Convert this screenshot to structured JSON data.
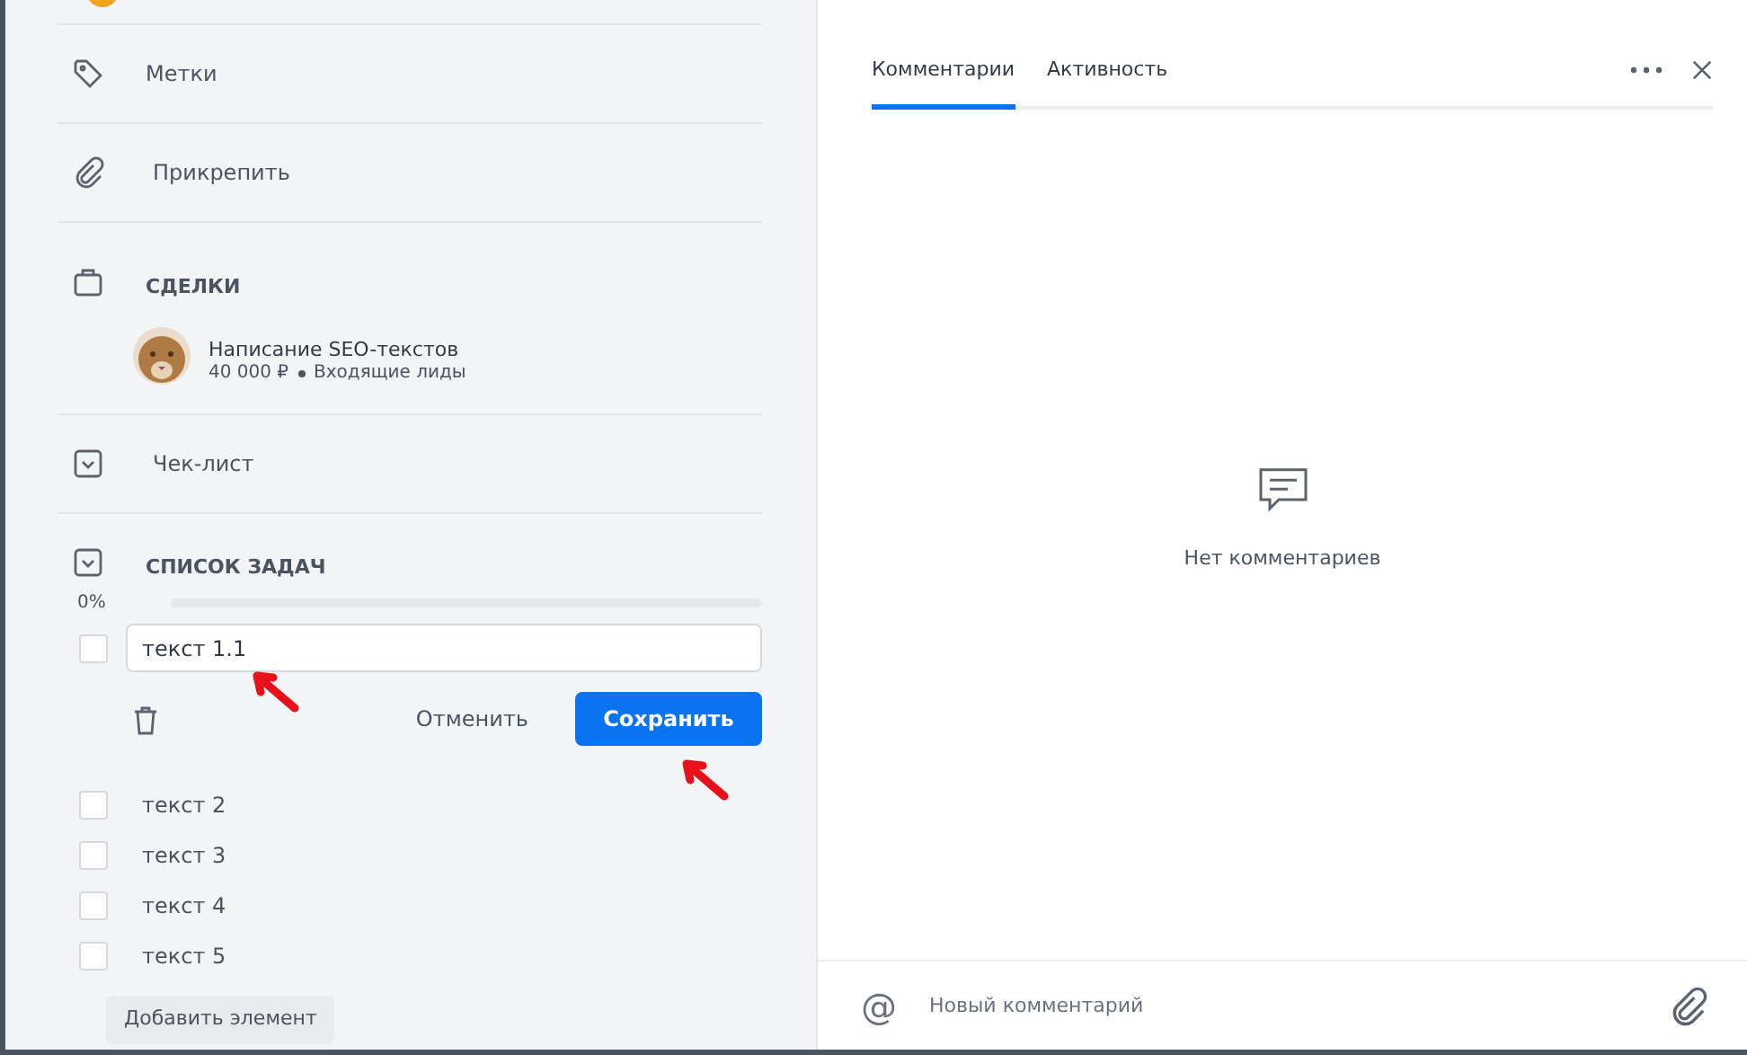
{
  "details": {
    "sections": [
      {
        "kind": "link",
        "label": "Метки"
      },
      {
        "kind": "link",
        "label": "Прикрепить"
      },
      {
        "kind": "deals",
        "label": "СДЕЛКИ",
        "deal": {
          "title": "Написание SEO-текстов",
          "amount": "40 000 ₽",
          "stage": "Входящие лиды"
        }
      },
      {
        "kind": "link",
        "label": "Чек-лист"
      }
    ],
    "tasklist": {
      "title": "СПИСОК ЗАДАЧ",
      "percent": "0%",
      "level": 0,
      "editing": {
        "checked": false,
        "value": "текст 1.1",
        "cancel": "Отменить",
        "save": "Сохранить"
      },
      "items": [
        {
          "label": "текст 2",
          "checked": false
        },
        {
          "label": "текст 3",
          "checked": false
        },
        {
          "label": "текст 4",
          "checked": false
        },
        {
          "label": "текст 5",
          "checked": false
        }
      ],
      "add": "Добавить элемент"
    }
  },
  "comments": {
    "tabs": [
      {
        "label": "Комментарии",
        "selected": true
      },
      {
        "label": "Активность",
        "selected": false
      }
    ],
    "empty": "Нет комментариев",
    "mention": "@",
    "placeholder": "Новый комментарий"
  }
}
